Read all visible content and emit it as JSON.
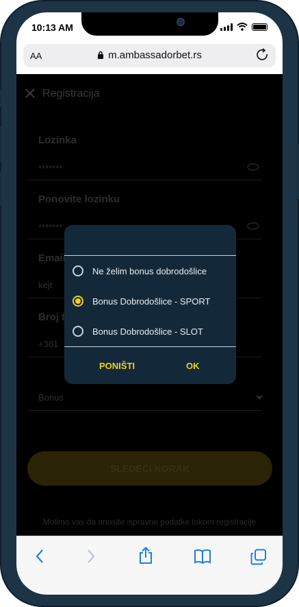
{
  "status_bar": {
    "time": "10:13 AM"
  },
  "browser": {
    "text_size_label": "AA",
    "url": "m.ambassadorbet.rs"
  },
  "page": {
    "title": "Registracija",
    "fields": [
      {
        "label": "Lozinka",
        "value": "*******"
      },
      {
        "label": "Ponovite lozinku",
        "value": "*******"
      },
      {
        "label": "Email",
        "value": "kejt"
      },
      {
        "label": "Broj t",
        "value": "+381"
      }
    ],
    "bonus_select_value": "Bonus",
    "next_button": "SLEDEĆI KORAK",
    "footnote": "Molimo vas da unosite ispravne podatke tokom registracije"
  },
  "dialog": {
    "options": [
      {
        "label": "Ne želim bonus dobrodošlice",
        "selected": false
      },
      {
        "label": "Bonus Dobrodošlice - SPORT",
        "selected": true
      },
      {
        "label": "Bonus Dobrodošlice - SLOT",
        "selected": false
      }
    ],
    "cancel_label": "PONIŠTI",
    "ok_label": "OK"
  },
  "colors": {
    "accent": "#f2cf1e",
    "dialog_bg": "#13293a",
    "ios_blue": "#1a7cf0"
  }
}
